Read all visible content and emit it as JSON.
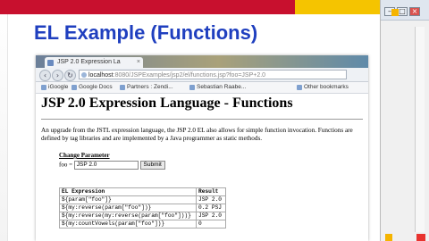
{
  "slide": {
    "title": "EL Example (Functions)",
    "colors": {
      "red_band": "#c8102e",
      "yellow_band": "#f5c400",
      "title": "#1f3fbf"
    }
  },
  "browser": {
    "tab_title": "JSP 2.0 Expression La",
    "address": {
      "host": "localhost",
      "path": ":8080/JSPExamples/jsp2/el/functions.jsp?foo=JSP+2.0"
    },
    "bookmarks": [
      "iGoogle",
      "Google Docs",
      "Partners : Zendi...",
      "Sebastian Raabe..."
    ],
    "other_bookmarks": "Other bookmarks"
  },
  "page": {
    "heading": "JSP 2.0 Expression Language - Functions",
    "intro": "An upgrade from the JSTL expression language, the JSP 2.0 EL also allows for simple function invocation. Functions are defined by tag libraries and are implemented by a Java programmer as static methods.",
    "form": {
      "label": "Change Parameter",
      "field_label": "foo =",
      "field_value": "JSP 2.0",
      "submit_label": "Submit"
    },
    "table": {
      "headers": [
        "EL Expression",
        "Result"
      ],
      "rows": [
        {
          "expr": "${param[\"foo\"]}",
          "result": "JSP 2.0"
        },
        {
          "expr": "${my:reverse(param[\"foo\"])}",
          "result": "0.2 PSJ"
        },
        {
          "expr": "${my:reverse(my:reverse(param[\"foo\"]))}",
          "result": "JSP 2.0"
        },
        {
          "expr": "${my:countVowels(param[\"foo\"])}",
          "result": "0"
        }
      ]
    }
  }
}
